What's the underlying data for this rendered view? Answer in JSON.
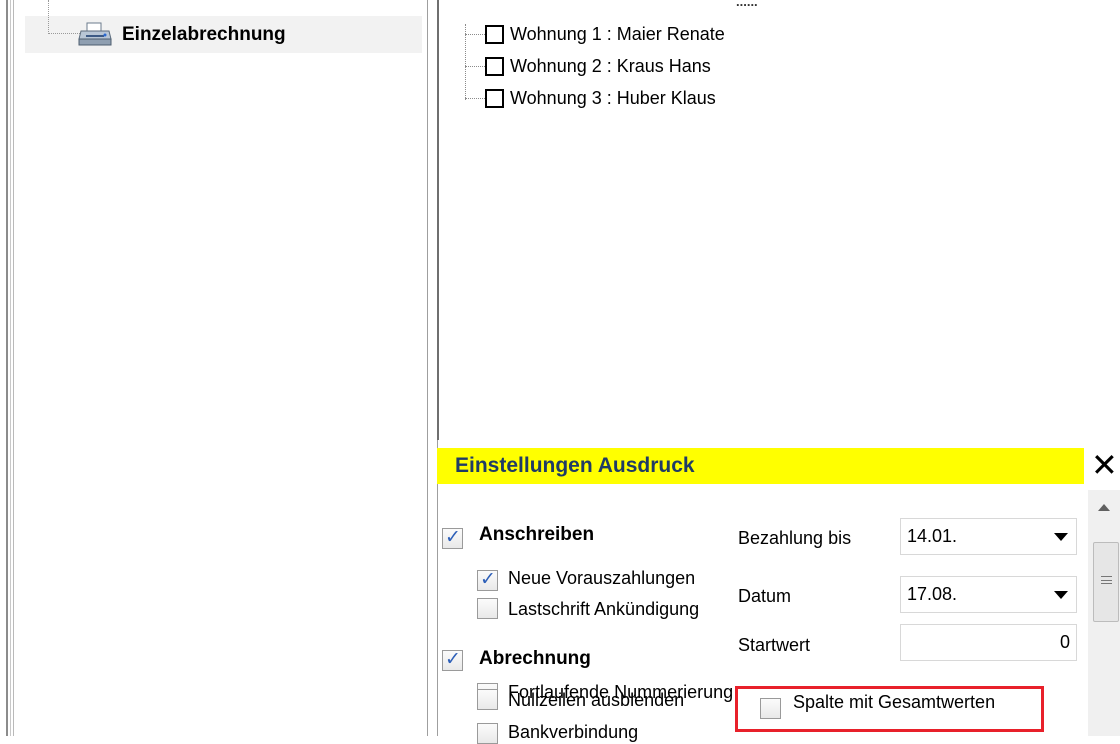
{
  "nav": {
    "items": [
      {
        "label": "Einzelabrechnung",
        "icon": "printer-icon"
      }
    ]
  },
  "apartments": {
    "header_stub": "......",
    "items": [
      {
        "label": "Wohnung 1 : Maier Renate",
        "checked": false
      },
      {
        "label": "Wohnung 2 : Kraus Hans",
        "checked": false
      },
      {
        "label": "Wohnung 3 : Huber Klaus",
        "checked": false
      }
    ]
  },
  "settings": {
    "title": "Einstellungen Ausdruck",
    "close_label": "✕",
    "anschreiben": {
      "label": "Anschreiben",
      "checked": true
    },
    "neue_vorauszahlungen": {
      "label": "Neue Vorauszahlungen",
      "checked": true
    },
    "lastschrift": {
      "label": "Lastschrift Ankündigung",
      "checked": false
    },
    "abrechnung": {
      "label": "Abrechnung",
      "checked": true
    },
    "fortlaufende": {
      "label": "Fortlaufende Nummerierung",
      "checked": false
    },
    "nullzeilen": {
      "label": "Nullzeilen ausblenden",
      "checked": false
    },
    "bankverbindung": {
      "label": "Bankverbindung",
      "checked": false
    },
    "spalte_gesamt": {
      "label": "Spalte mit Gesamtwerten",
      "checked": false
    },
    "bezahlung_bis": {
      "label": "Bezahlung bis",
      "value": "14.01."
    },
    "datum": {
      "label": "Datum",
      "value": "17.08."
    },
    "startwert": {
      "label": "Startwert",
      "value": "0"
    },
    "highlight_color": "#e8202a",
    "header_color": "#ffff00"
  }
}
